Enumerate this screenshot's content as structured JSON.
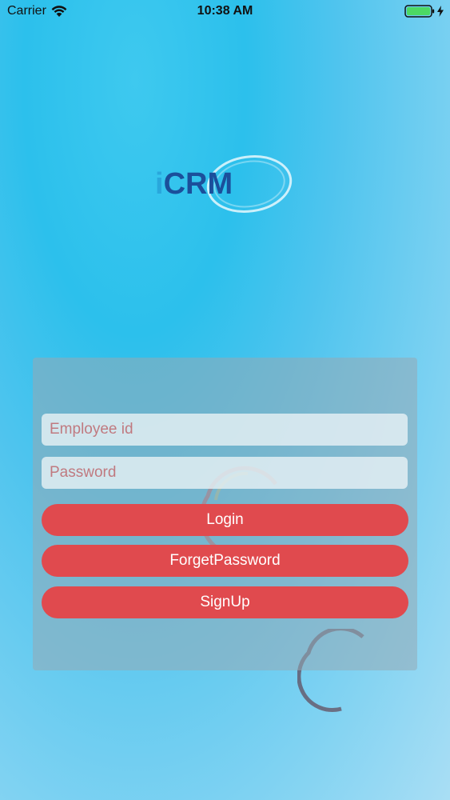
{
  "status_bar": {
    "carrier": "Carrier",
    "time": "10:38 AM"
  },
  "logo": {
    "text": "iCRM",
    "colors": {
      "i": "#29a7dc",
      "crm": "#1b4f9b",
      "swoosh": "#ffffff"
    }
  },
  "login_form": {
    "employee_id_placeholder": "Employee id",
    "password_placeholder": "Password",
    "login_label": "Login",
    "forget_password_label": "ForgetPassword",
    "signup_label": "SignUp"
  },
  "colors": {
    "button": "#e04a4e",
    "battery": "#4cd964",
    "placeholder": "#c07a80"
  },
  "icons": [
    "wifi-icon",
    "battery-icon",
    "charging-bolt-icon",
    "logo-swoosh",
    "loading-spinner-icon"
  ]
}
